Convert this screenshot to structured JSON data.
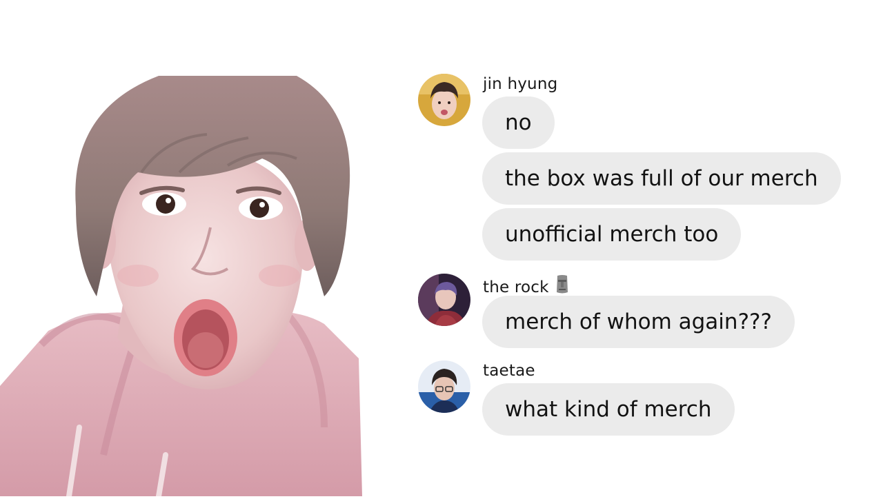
{
  "messages": [
    {
      "sender": "jin hyung",
      "sender_emoji": "moai-icon",
      "avatar": "jin-avatar",
      "bubbles": [
        "no",
        "the box was full of our merch",
        "unofficial merch too"
      ]
    },
    {
      "sender": "the rock",
      "sender_emoji": "moai-icon",
      "avatar": "the-rock-avatar",
      "bubbles": [
        "merch of whom again???"
      ]
    },
    {
      "sender": "taetae",
      "avatar": "taetae-avatar",
      "bubbles": [
        "what kind of merch"
      ]
    }
  ],
  "colors": {
    "background": "#ffffff",
    "bubble": "#ebebeb",
    "text": "#121212"
  }
}
